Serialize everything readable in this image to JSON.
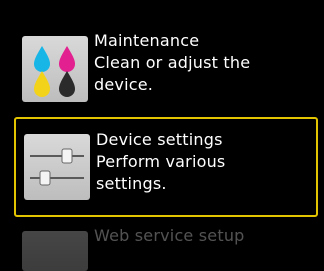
{
  "menu": {
    "items": [
      {
        "title": "Maintenance",
        "description_line1": "Clean or adjust the",
        "description_line2": "device.",
        "icon": "ink-cartridge-icon"
      },
      {
        "title": "Device settings",
        "description_line1": "Perform various",
        "description_line2": "settings.",
        "icon": "sliders-icon",
        "selected": true
      },
      {
        "title": "Web service setup",
        "icon": "web-service-icon"
      }
    ]
  },
  "colors": {
    "background": "#000000",
    "text": "#ffffff",
    "selection_border": "#e2c400"
  }
}
